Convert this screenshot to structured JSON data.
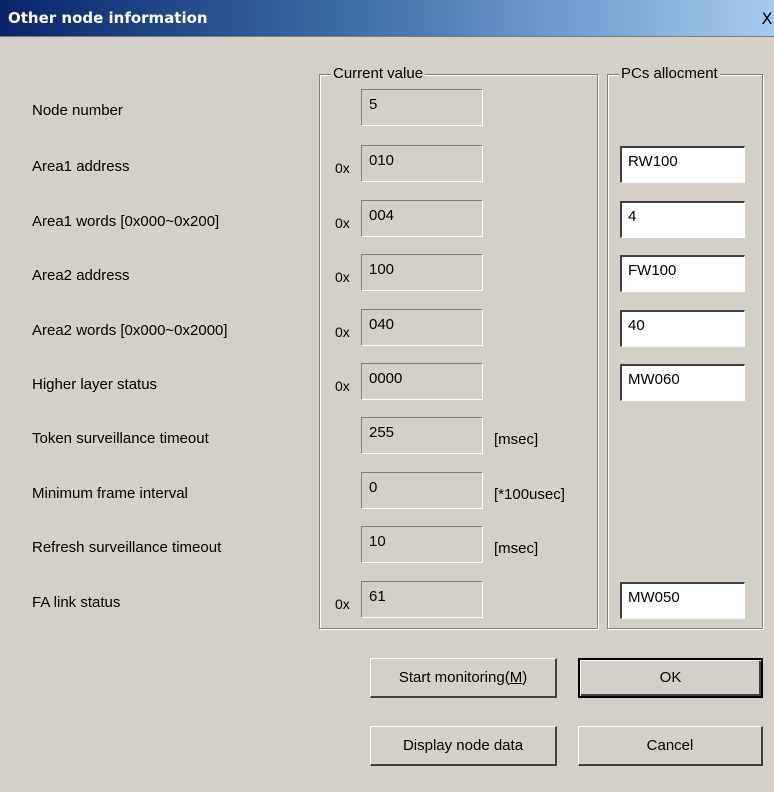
{
  "window": {
    "title": "Other node information",
    "close_glyph": "X"
  },
  "groups": {
    "current_value": "Current value",
    "pcs_allocment": "PCs allocment"
  },
  "rows": [
    {
      "label": "Node number",
      "prefix": "",
      "value": "5",
      "unit": "",
      "alloc": null
    },
    {
      "label": "Area1 address",
      "prefix": "0x",
      "value": "010",
      "unit": "",
      "alloc": "RW100"
    },
    {
      "label": "Area1 words [0x000~0x200]",
      "prefix": "0x",
      "value": "004",
      "unit": "",
      "alloc": "4"
    },
    {
      "label": "Area2 address",
      "prefix": "0x",
      "value": "100",
      "unit": "",
      "alloc": "FW100"
    },
    {
      "label": "Area2 words [0x000~0x2000]",
      "prefix": "0x",
      "value": "040",
      "unit": "",
      "alloc": "40"
    },
    {
      "label": "Higher layer status",
      "prefix": "0x",
      "value": "0000",
      "unit": "",
      "alloc": "MW060"
    },
    {
      "label": "Token surveillance timeout",
      "prefix": "",
      "value": "255",
      "unit": "[msec]",
      "alloc": null
    },
    {
      "label": "Minimum frame interval",
      "prefix": "",
      "value": "0",
      "unit": "[*100usec]",
      "alloc": null
    },
    {
      "label": "Refresh surveillance timeout",
      "prefix": "",
      "value": "10",
      "unit": "[msec]",
      "alloc": null
    },
    {
      "label": "FA link status",
      "prefix": "0x",
      "value": "61",
      "unit": "",
      "alloc": "MW050"
    }
  ],
  "buttons": {
    "start_monitoring_prefix": "Start monitoring(",
    "start_monitoring_mnemonic": "M",
    "start_monitoring_suffix": ")",
    "ok": "OK",
    "display_node_data": "Display node data",
    "cancel": "Cancel"
  }
}
